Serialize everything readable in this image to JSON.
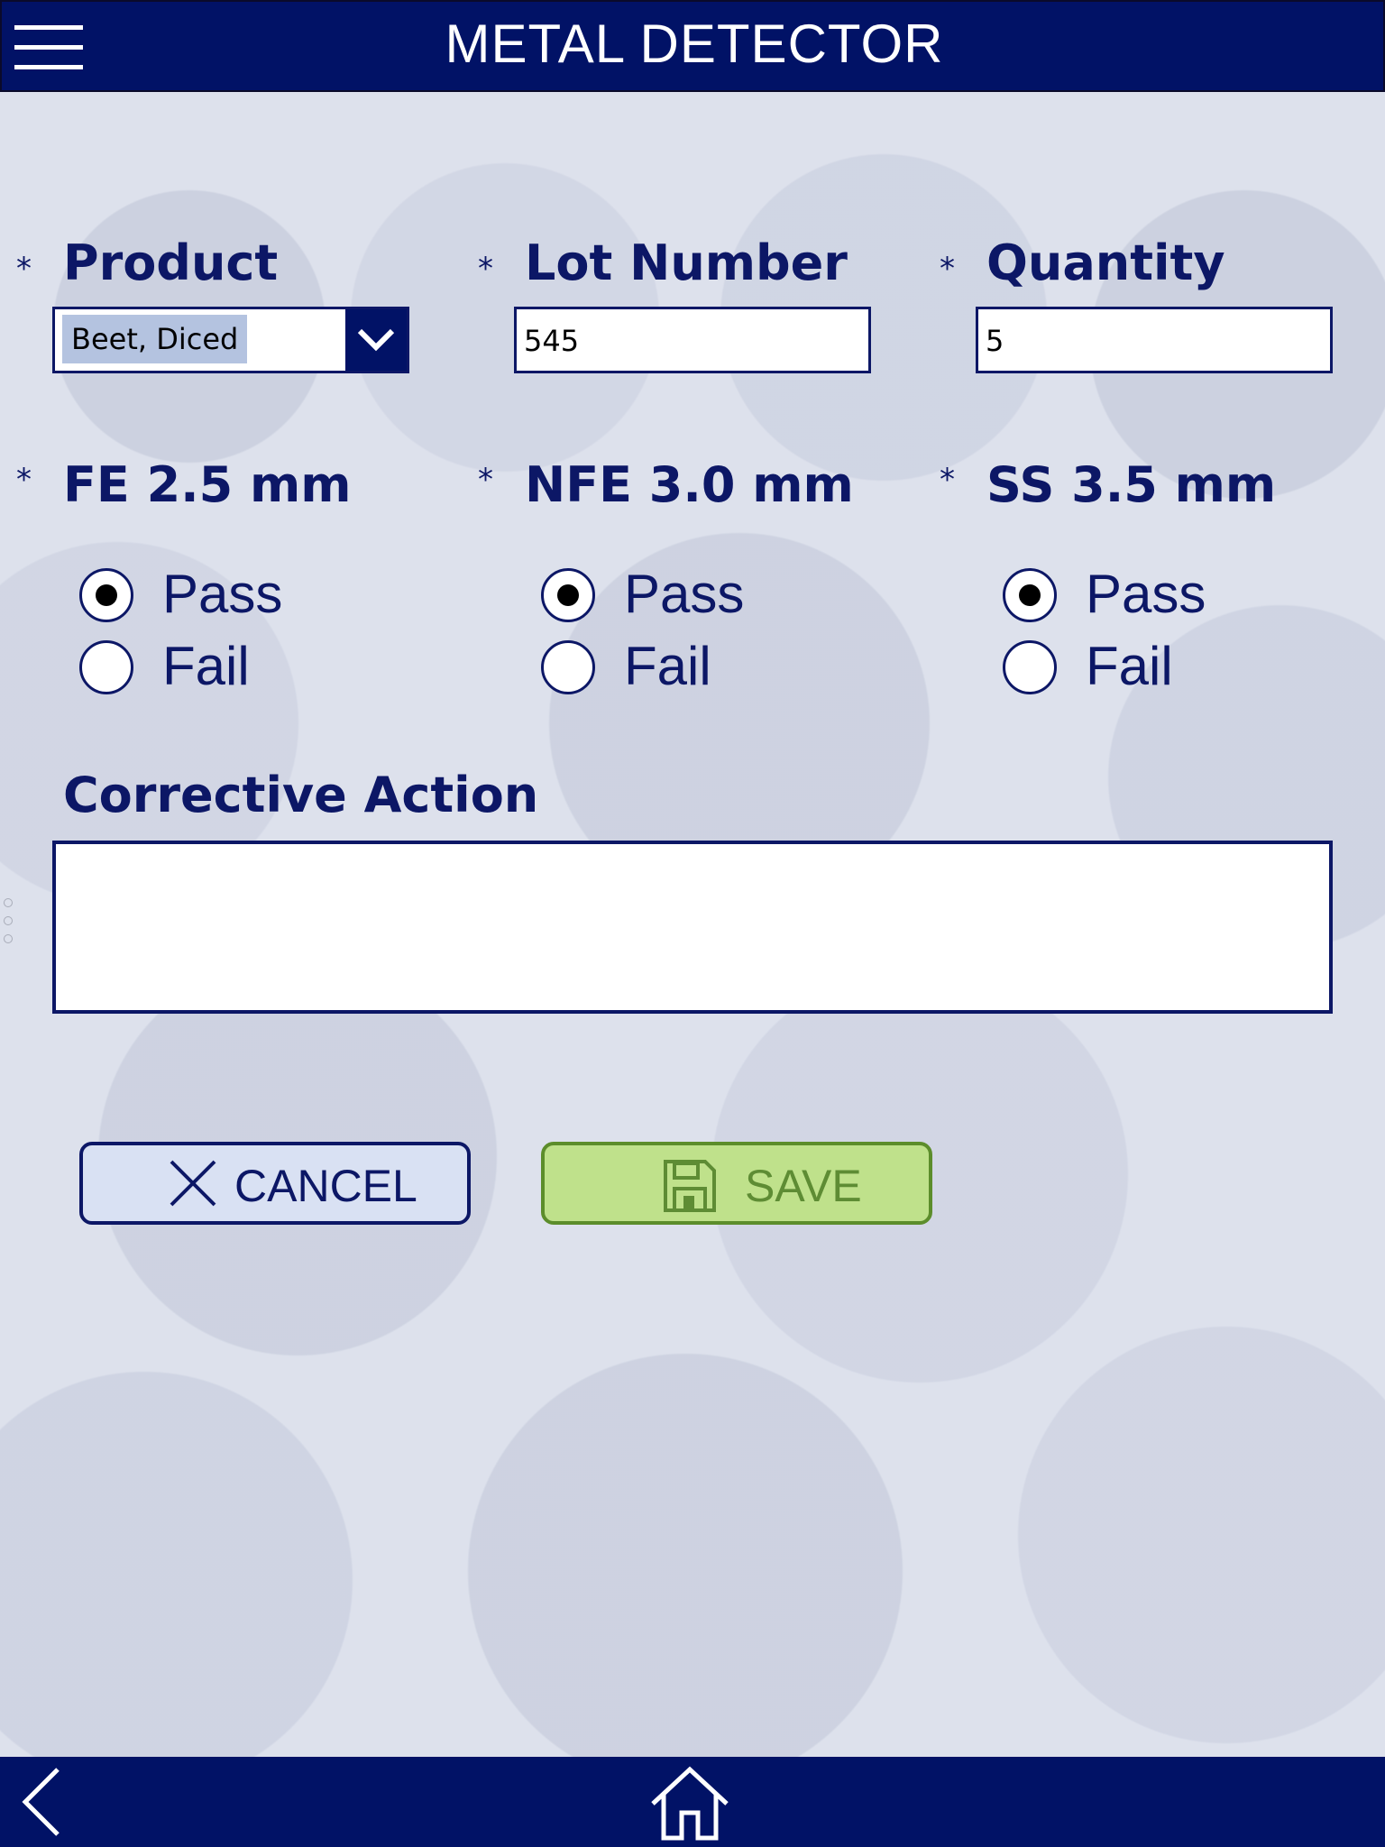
{
  "header": {
    "title": "METAL DETECTOR",
    "menu_icon": "hamburger-menu-icon"
  },
  "form": {
    "required_marker": "*",
    "product": {
      "label": "Product",
      "selected": "Beet, Diced",
      "icon": "chevron-down-icon"
    },
    "lot_number": {
      "label": "Lot Number",
      "value": "545"
    },
    "quantity": {
      "label": "Quantity",
      "value": "5"
    },
    "tests": [
      {
        "label": "FE 2.5 mm",
        "options": [
          "Pass",
          "Fail"
        ],
        "selected": "Pass"
      },
      {
        "label": "NFE 3.0 mm",
        "options": [
          "Pass",
          "Fail"
        ],
        "selected": "Pass"
      },
      {
        "label": "SS 3.5 mm",
        "options": [
          "Pass",
          "Fail"
        ],
        "selected": "Pass"
      }
    ],
    "corrective_action": {
      "label": "Corrective Action",
      "value": ""
    }
  },
  "buttons": {
    "cancel": {
      "label": "CANCEL",
      "icon": "close-icon"
    },
    "save": {
      "label": "SAVE",
      "icon": "floppy-disk-icon"
    }
  },
  "footer": {
    "back_icon": "chevron-left-icon",
    "home_icon": "home-icon"
  },
  "colors": {
    "primary": "#011266",
    "text": "#0c1766",
    "save_bg": "#bfe18b",
    "cancel_bg": "#d9e1f3"
  }
}
